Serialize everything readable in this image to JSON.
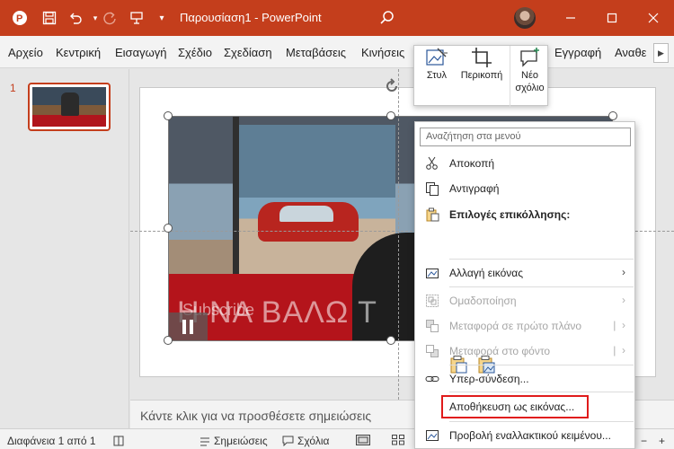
{
  "titlebar": {
    "title": "Παρουσίαση1 - PowerPoint",
    "bg_color": "#c43e1c"
  },
  "ribbon": {
    "tabs": [
      "Αρχείο",
      "Κεντρική",
      "Εισαγωγή",
      "Σχέδιο",
      "Σχεδίαση",
      "Μεταβάσεις",
      "Κινήσεις",
      "Εγγραφή",
      "Αναθε"
    ]
  },
  "thumbnails": {
    "slide_number": "1"
  },
  "video": {
    "overlay_text": "Η ΝΑ ΒΑΛΩ Τ",
    "overlay_sub": "Subscribe"
  },
  "notes": {
    "placeholder": "Κάντε κλικ για να προσθέσετε σημειώσεις"
  },
  "statusbar": {
    "slide_info": "Διαφάνεια 1 από 1",
    "notes_label": "Σημειώσεις",
    "comments_label": "Σχόλια"
  },
  "mini_toolbar": {
    "style_label": "Στυλ",
    "crop_label": "Περικοπή",
    "new_comment_line1": "Νέο",
    "new_comment_line2": "σχόλιο"
  },
  "context_menu": {
    "search_placeholder": "Αναζήτηση στα μενού",
    "cut": "Αποκοπή",
    "copy": "Αντιγραφή",
    "paste_options": "Επιλογές επικόλλησης:",
    "change_picture": "Αλλαγή εικόνας",
    "group": "Ομαδοποίηση",
    "bring_front": "Μεταφορά σε πρώτο πλάνο",
    "send_back": "Μεταφορά στο φόντο",
    "hyperlink": "Υπερ-σύνδεση...",
    "save_as_picture": "Αποθήκευση ως εικόνας...",
    "alt_text": "Προβολή εναλλακτικού κειμένου..."
  },
  "colors": {
    "accent": "#c43e1c",
    "highlight": "#e01b1b"
  }
}
